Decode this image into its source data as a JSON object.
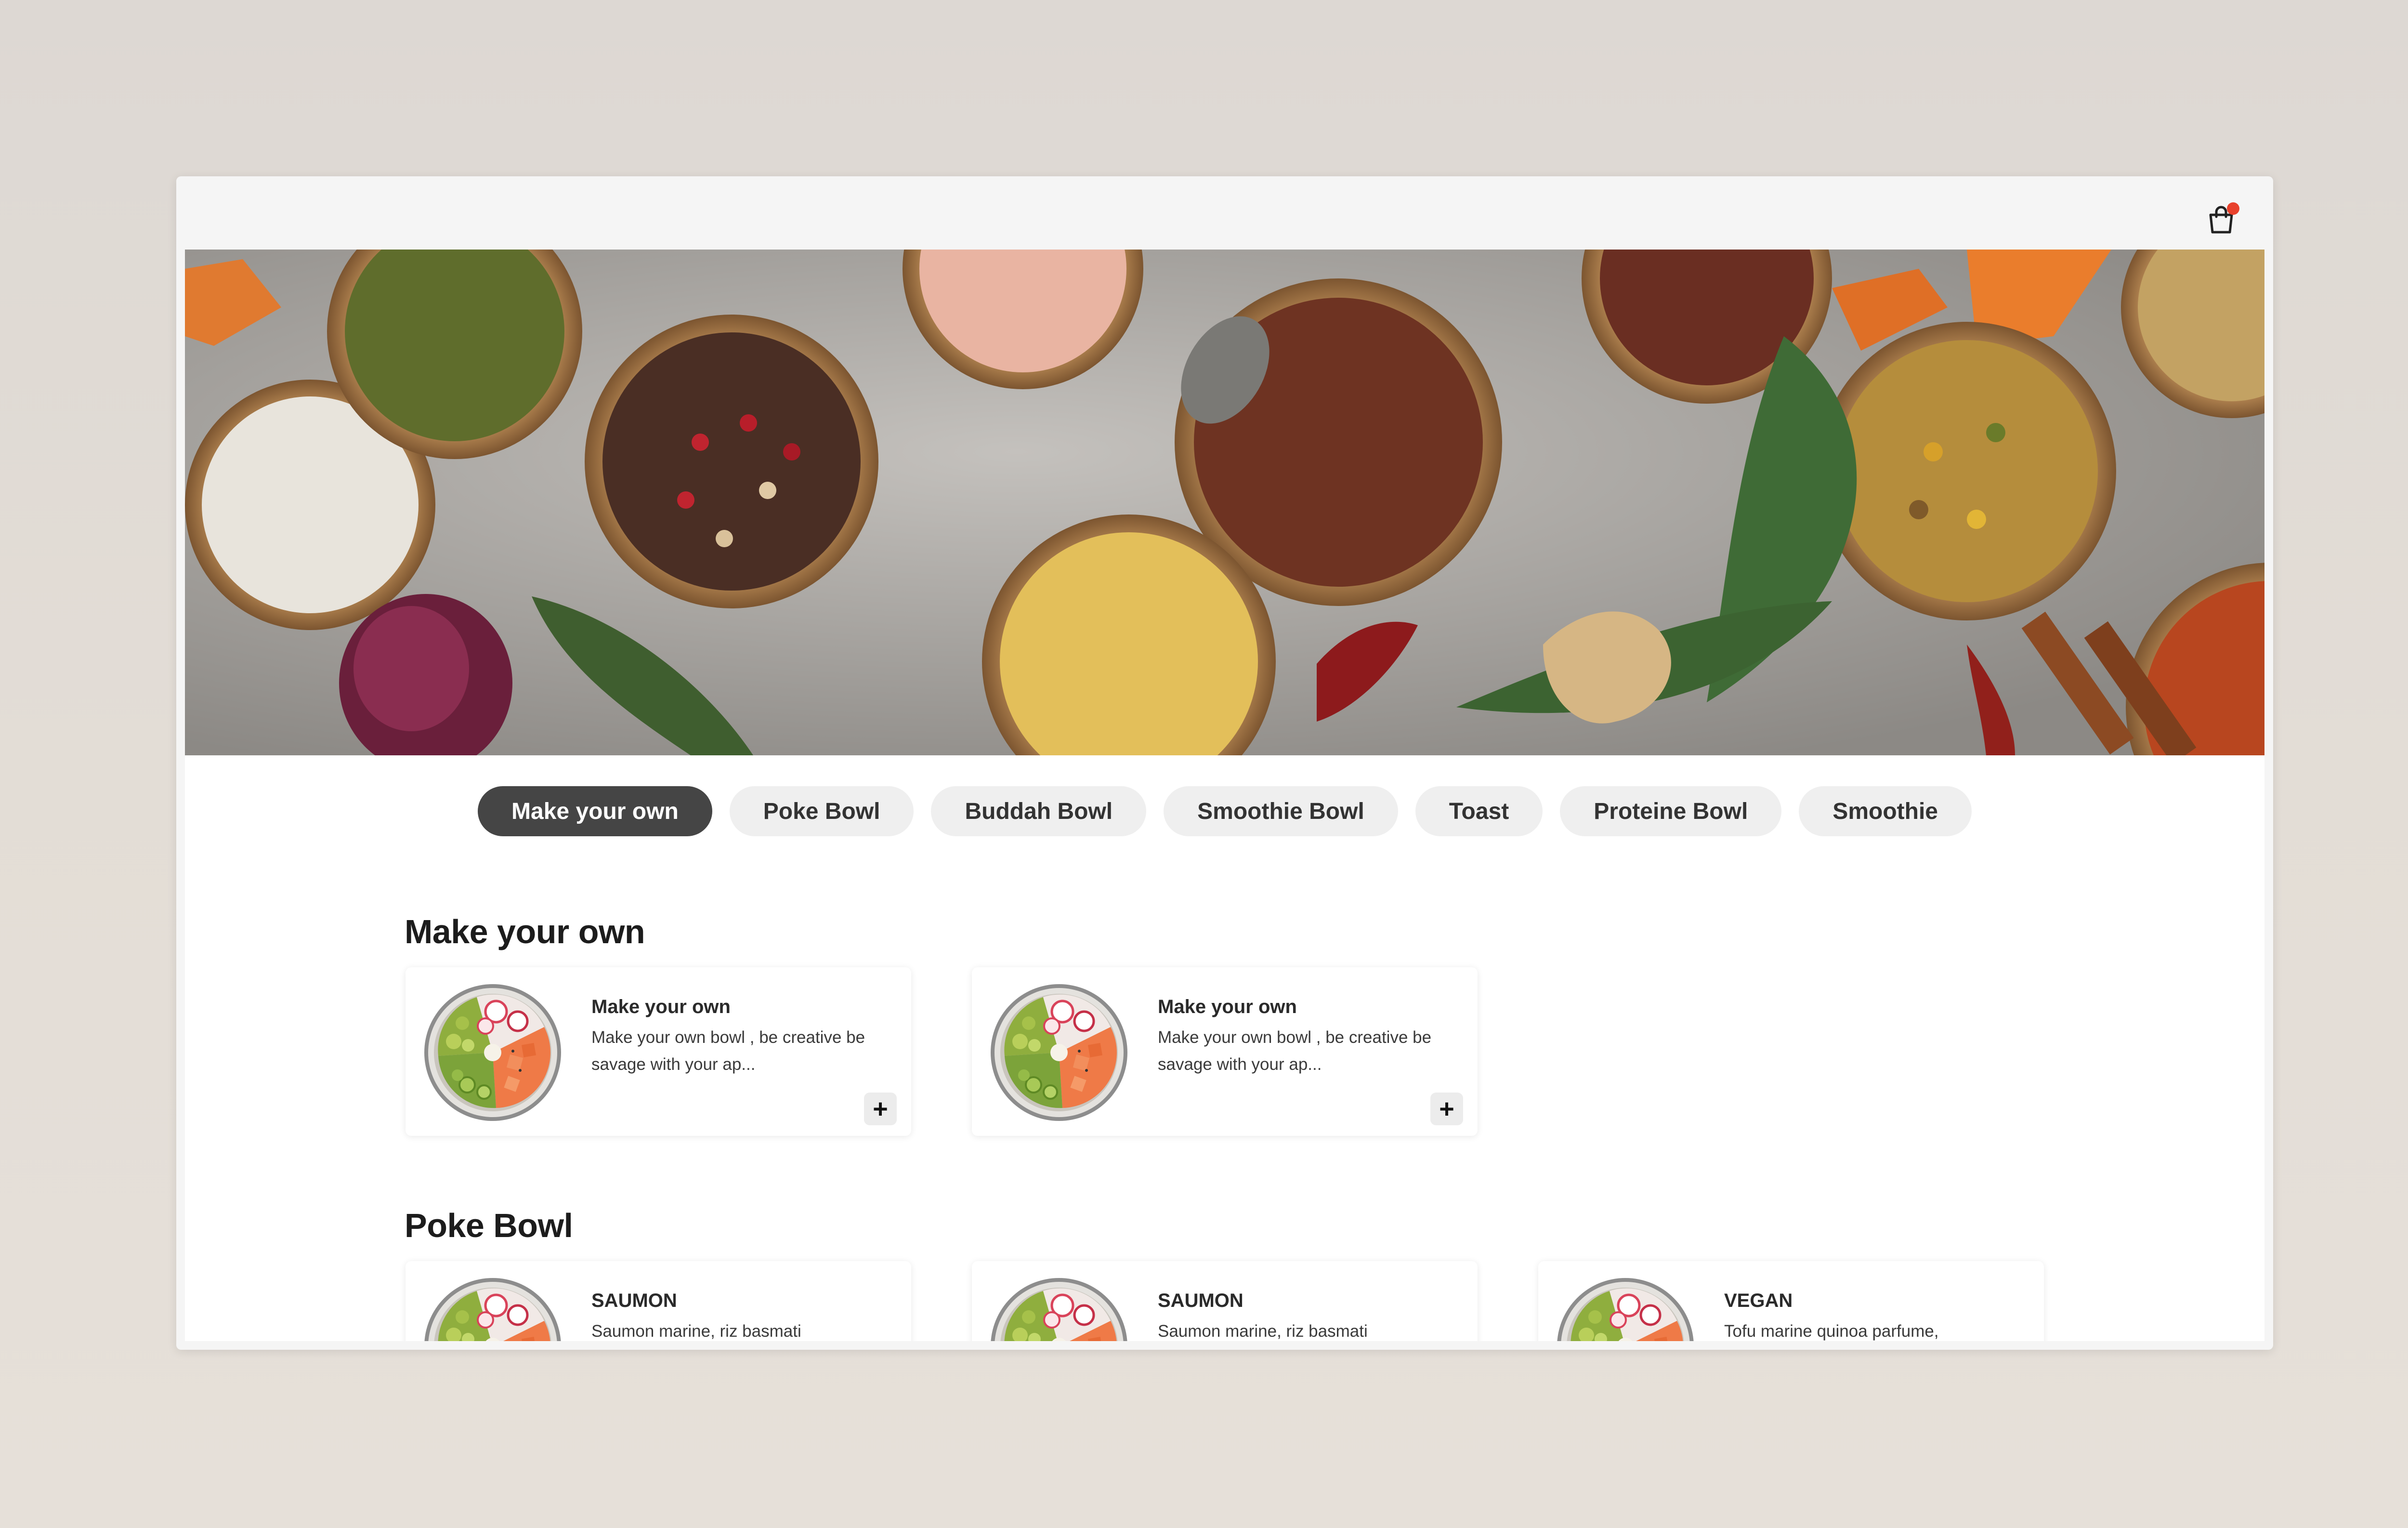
{
  "header": {
    "cart_icon": "shopping-bag-icon",
    "cart_badge_color": "#e8412c"
  },
  "categories": [
    {
      "label": "Make your own",
      "active": true
    },
    {
      "label": "Poke Bowl",
      "active": false
    },
    {
      "label": "Buddah Bowl",
      "active": false
    },
    {
      "label": "Smoothie Bowl",
      "active": false
    },
    {
      "label": "Toast",
      "active": false
    },
    {
      "label": "Proteine Bowl",
      "active": false
    },
    {
      "label": "Smoothie",
      "active": false
    }
  ],
  "sections": [
    {
      "title": "Make your own",
      "items": [
        {
          "name": "Make your own",
          "desc": "Make your own bowl , be creative be savage with your ap...",
          "add": "+"
        },
        {
          "name": "Make your own",
          "desc": "Make your own bowl , be creative be savage with your ap...",
          "add": "+"
        }
      ]
    },
    {
      "title": "Poke Bowl",
      "items": [
        {
          "name": "SAUMON",
          "desc": "Saumon marine, riz basmati"
        },
        {
          "name": "SAUMON",
          "desc": "Saumon marine, riz basmati"
        },
        {
          "name": "VEGAN",
          "desc": "Tofu marine quinoa parfume,"
        }
      ]
    }
  ],
  "colors": {
    "active_pill": "#454545",
    "pill": "#efefef",
    "accent": "#e8412c"
  }
}
